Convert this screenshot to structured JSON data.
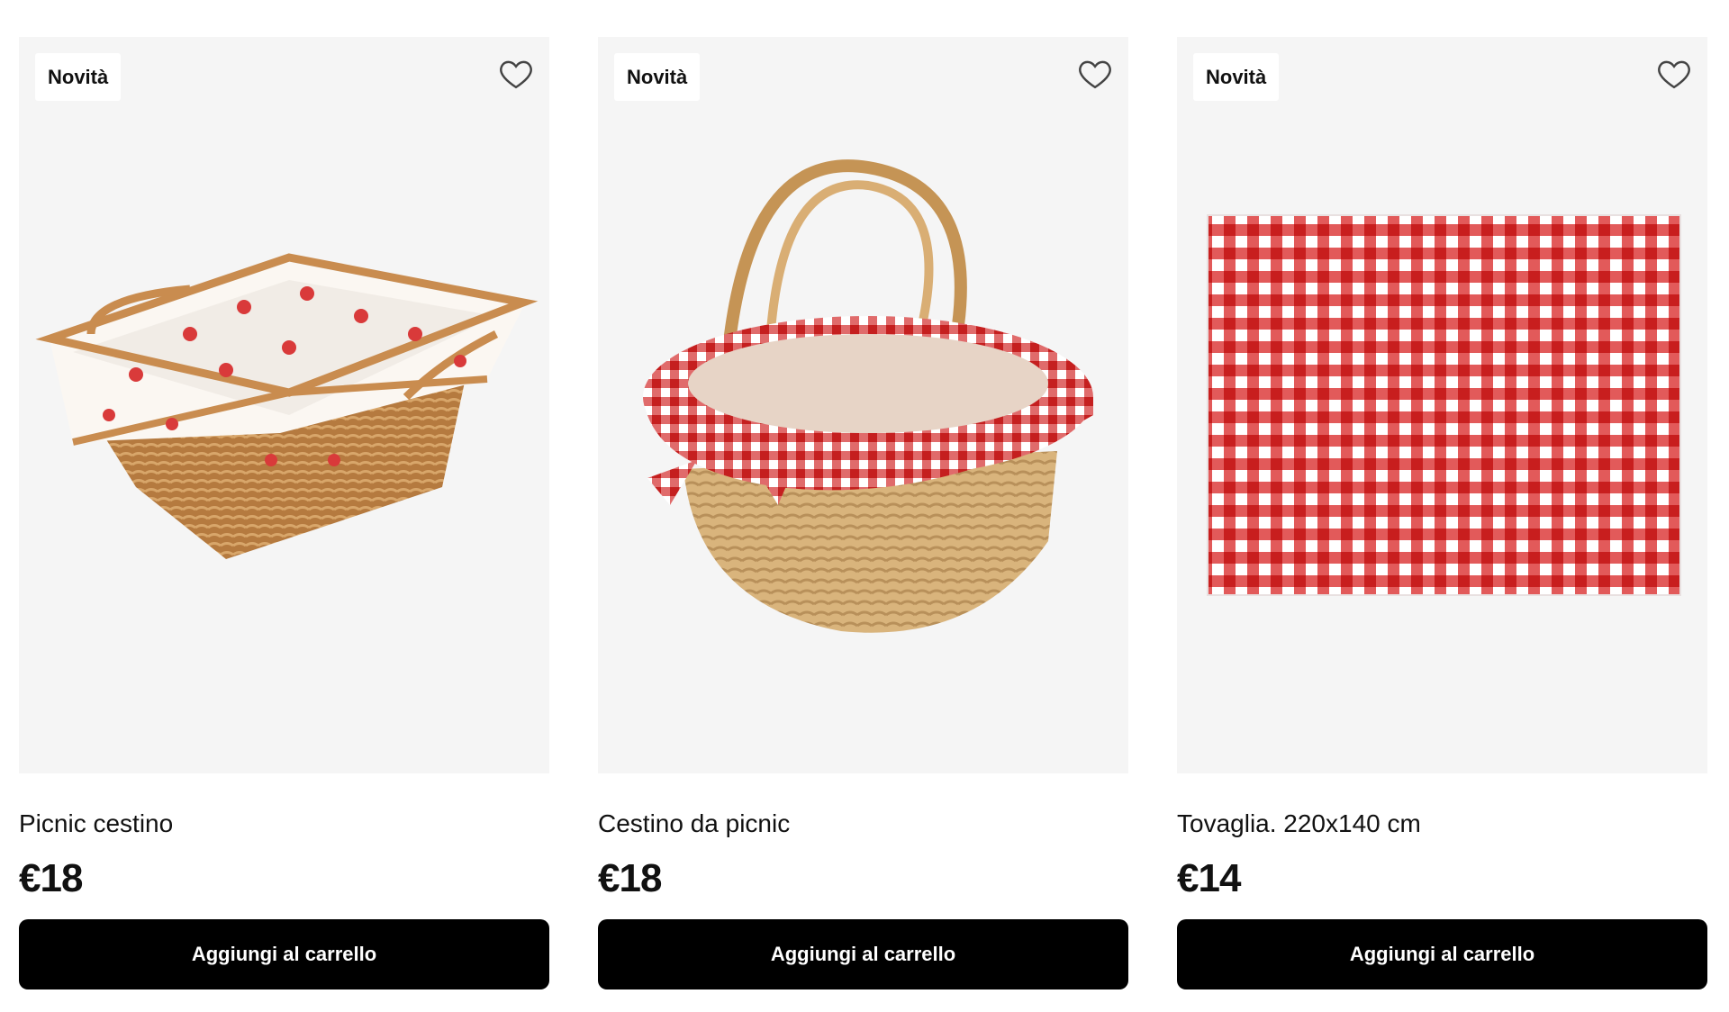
{
  "products": [
    {
      "badge": "Novità",
      "title": "Picnic cestino",
      "price": "€18",
      "cart_label": "Aggiungi al carrello",
      "image_icon": "wicker-basket-strawberry-lining"
    },
    {
      "badge": "Novità",
      "title": "Cestino da picnic",
      "price": "€18",
      "cart_label": "Aggiungi al carrello",
      "image_icon": "wicker-basket-gingham-lining"
    },
    {
      "badge": "Novità",
      "title": "Tovaglia. 220x140 cm",
      "price": "€14",
      "cart_label": "Aggiungi al carrello",
      "image_icon": "gingham-tablecloth"
    }
  ],
  "colors": {
    "card_bg": "#f5f5f5",
    "button_bg": "#000000",
    "gingham_red": "#d92b2b",
    "wicker": "#c9955a"
  }
}
